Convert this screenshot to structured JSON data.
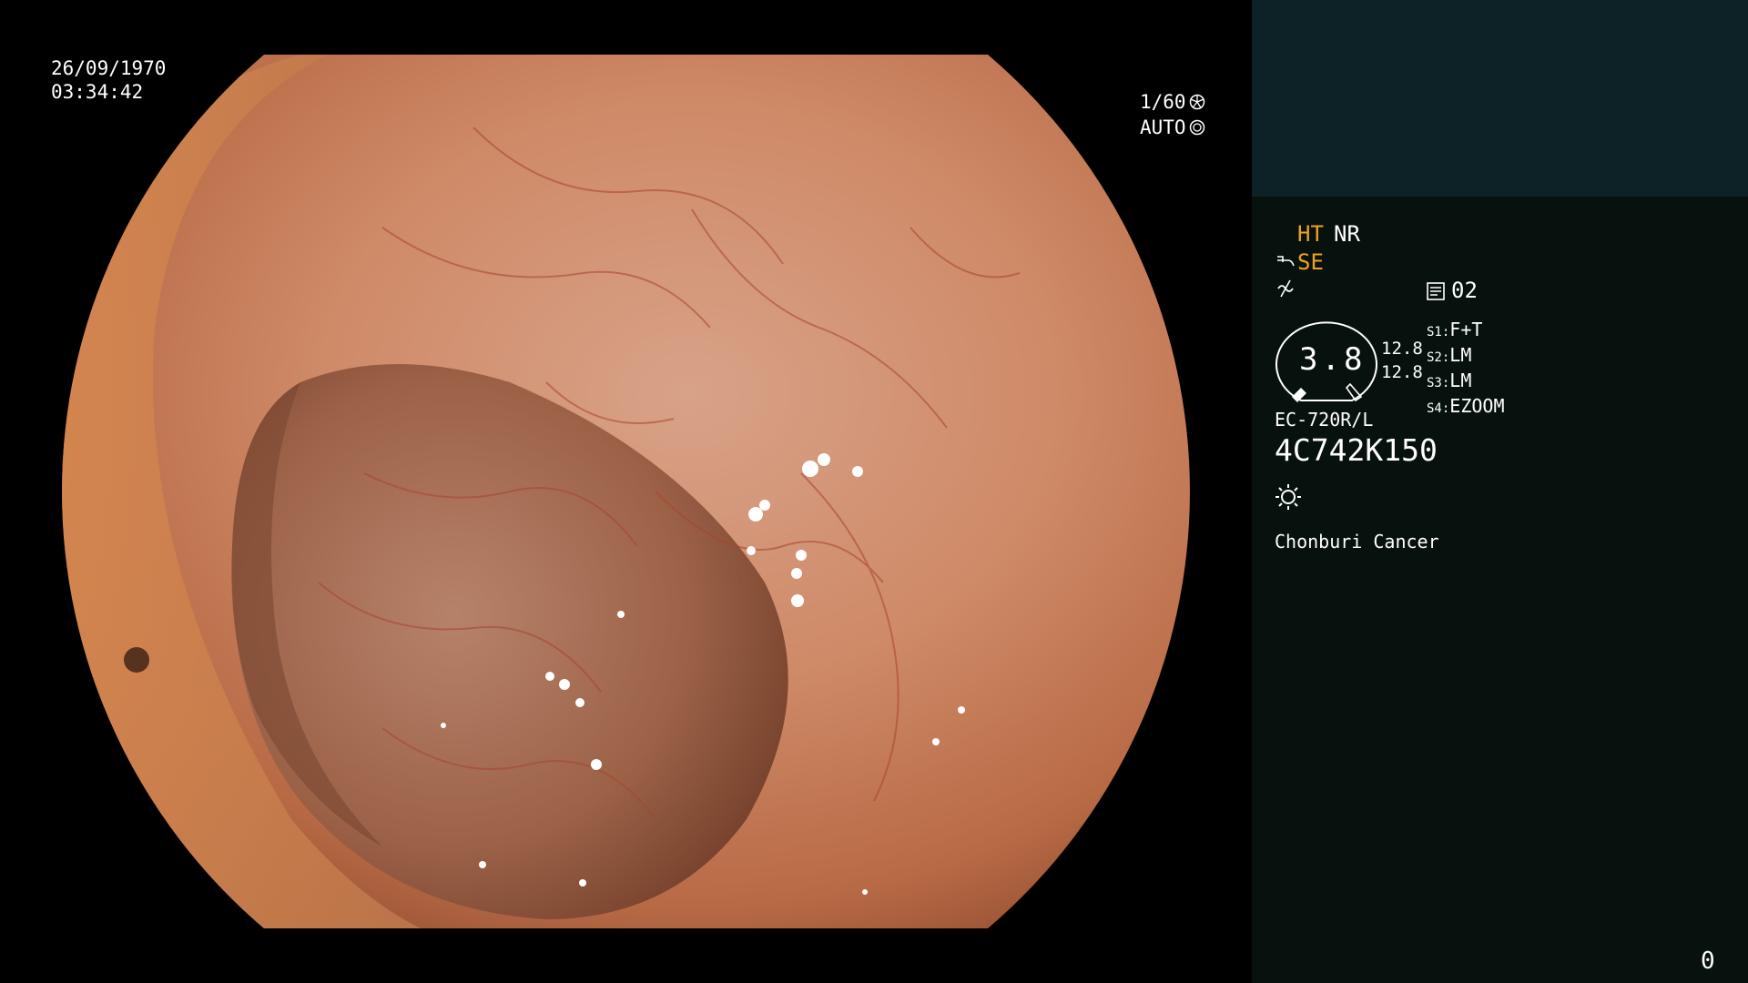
{
  "header": {
    "date": "26/09/1970",
    "time": "03:34:42",
    "shutter": "1/60",
    "iris": "AUTO"
  },
  "icons": {
    "shutter": "shutter-icon",
    "iris": "iris-icon",
    "structure": "structure-enhance-icon",
    "color": "color-mode-icon",
    "memory": "memory-card-icon",
    "light": "light-source-icon"
  },
  "panel": {
    "ht": "HT",
    "nr": "NR",
    "se": "SE",
    "memory_count": "02",
    "gauge_value": "3.8",
    "gauge_val_top": "12.8",
    "gauge_val_bottom": "12.8",
    "s_labels": [
      "S1:",
      "S2:",
      "S3:",
      "S4:"
    ],
    "s_values": [
      "F+T",
      "LM",
      "LM",
      "EZOOM"
    ],
    "model": "EC-720R/L",
    "serial": "4C742K150",
    "institution": "Chonburi Cancer"
  },
  "footer": {
    "counter": "0"
  },
  "colors": {
    "accent": "#f0a020",
    "panel_bg": "#07120f",
    "panel_top": "#0d2226"
  }
}
